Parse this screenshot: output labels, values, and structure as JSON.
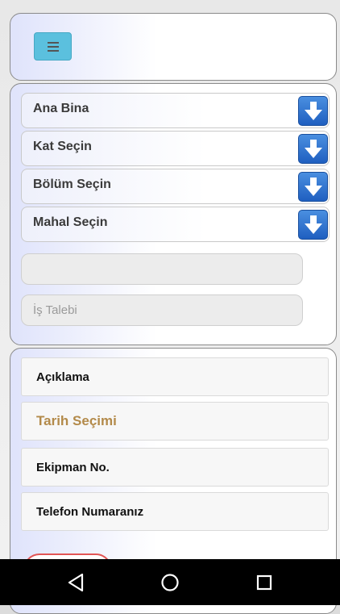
{
  "selects": [
    {
      "label": "Ana Bina"
    },
    {
      "label": "Kat Seçin"
    },
    {
      "label": "Bölüm Seçin"
    },
    {
      "label": "Mahal Seçin"
    }
  ],
  "inputs": {
    "first_value": "",
    "first_placeholder": "",
    "is_talebi_placeholder": "İş Talebi"
  },
  "details": {
    "aciklama": "Açıklama",
    "tarih": "Tarih Seçimi",
    "ekipman": "Ekipman No.",
    "telefon": "Telefon Numaranız"
  },
  "colors": {
    "menu_button": "#5bc0de",
    "arrow_button": "#2f73d2",
    "date_accent": "#b38a4a",
    "partial_button_border": "#e25555"
  },
  "icons": {
    "menu": "hamburger-icon",
    "select_arrow": "arrow-down-icon",
    "nav_back": "back-triangle-icon",
    "nav_home": "home-circle-icon",
    "nav_recents": "recents-square-icon"
  }
}
